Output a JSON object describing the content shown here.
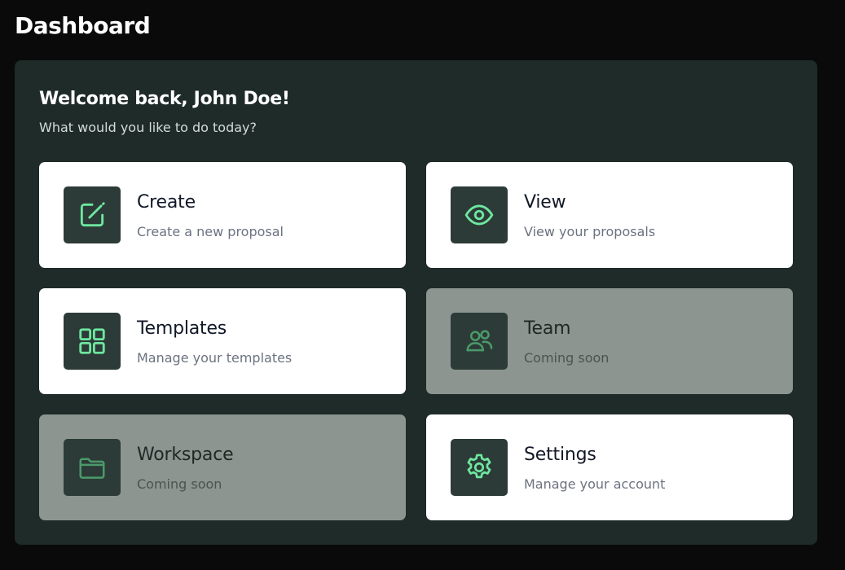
{
  "header": {
    "title": "Dashboard"
  },
  "welcome": {
    "title": "Welcome back, John Doe!",
    "subtitle": "What would you like to do today?"
  },
  "colors": {
    "background": "#0a0a0a",
    "panel": "#1e2b28",
    "icon_tile": "#2c3b37",
    "icon_accent": "#6ee7a0",
    "icon_accent_disabled": "#4b9a6a",
    "card_disabled": "#8c9590"
  },
  "cards": [
    {
      "title": "Create",
      "description": "Create a new proposal",
      "icon": "edit-icon",
      "enabled": true
    },
    {
      "title": "View",
      "description": "View your proposals",
      "icon": "eye-icon",
      "enabled": true
    },
    {
      "title": "Templates",
      "description": "Manage your templates",
      "icon": "grid-icon",
      "enabled": true
    },
    {
      "title": "Team",
      "description": "Coming soon",
      "icon": "users-icon",
      "enabled": false
    },
    {
      "title": "Workspace",
      "description": "Coming soon",
      "icon": "folder-icon",
      "enabled": false
    },
    {
      "title": "Settings",
      "description": "Manage your account",
      "icon": "gear-icon",
      "enabled": true
    }
  ]
}
